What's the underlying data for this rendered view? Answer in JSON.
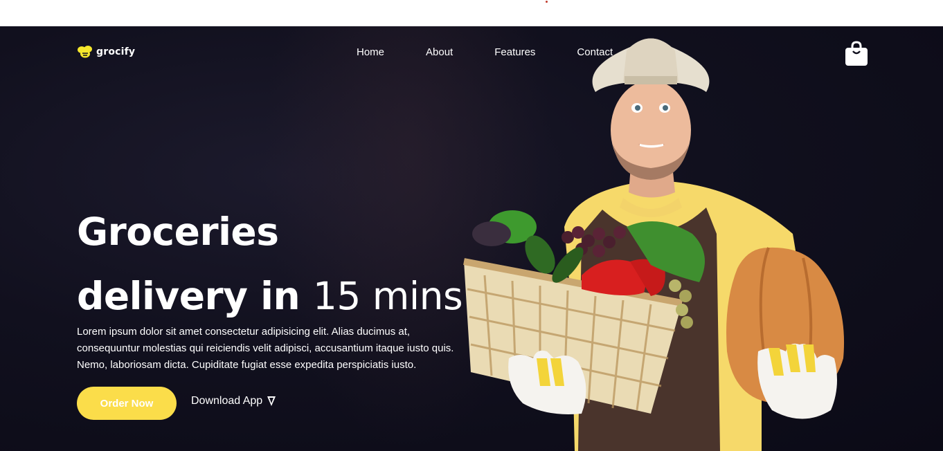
{
  "brand": {
    "name": "grocify",
    "logo_icon": "bee-icon",
    "accent": "#fbdd4a"
  },
  "nav": {
    "items": [
      {
        "label": "Home"
      },
      {
        "label": "About"
      },
      {
        "label": "Features"
      },
      {
        "label": "Contact"
      }
    ],
    "cart_icon": "shopping-bag-icon"
  },
  "hero": {
    "title_line1": "Groceries",
    "title_line2_bold": "delivery in",
    "title_line2_light": "15 mins",
    "description": "Lorem ipsum dolor sit amet consectetur adipisicing elit. Alias ducimus at, consequuntur molestias qui reiciendis velit adipisci, accusantium itaque iusto quis. Nemo, laboriosam dicta. Cupiditate fugiat esse expedita perspiciatis iusto.",
    "primary_button": "Order Now",
    "secondary_button": "Download App",
    "secondary_icon": "cursor-arrow-icon"
  },
  "colors": {
    "hero_bg": "#11101e",
    "button_bg": "#fbdd4a",
    "text": "#ffffff"
  }
}
